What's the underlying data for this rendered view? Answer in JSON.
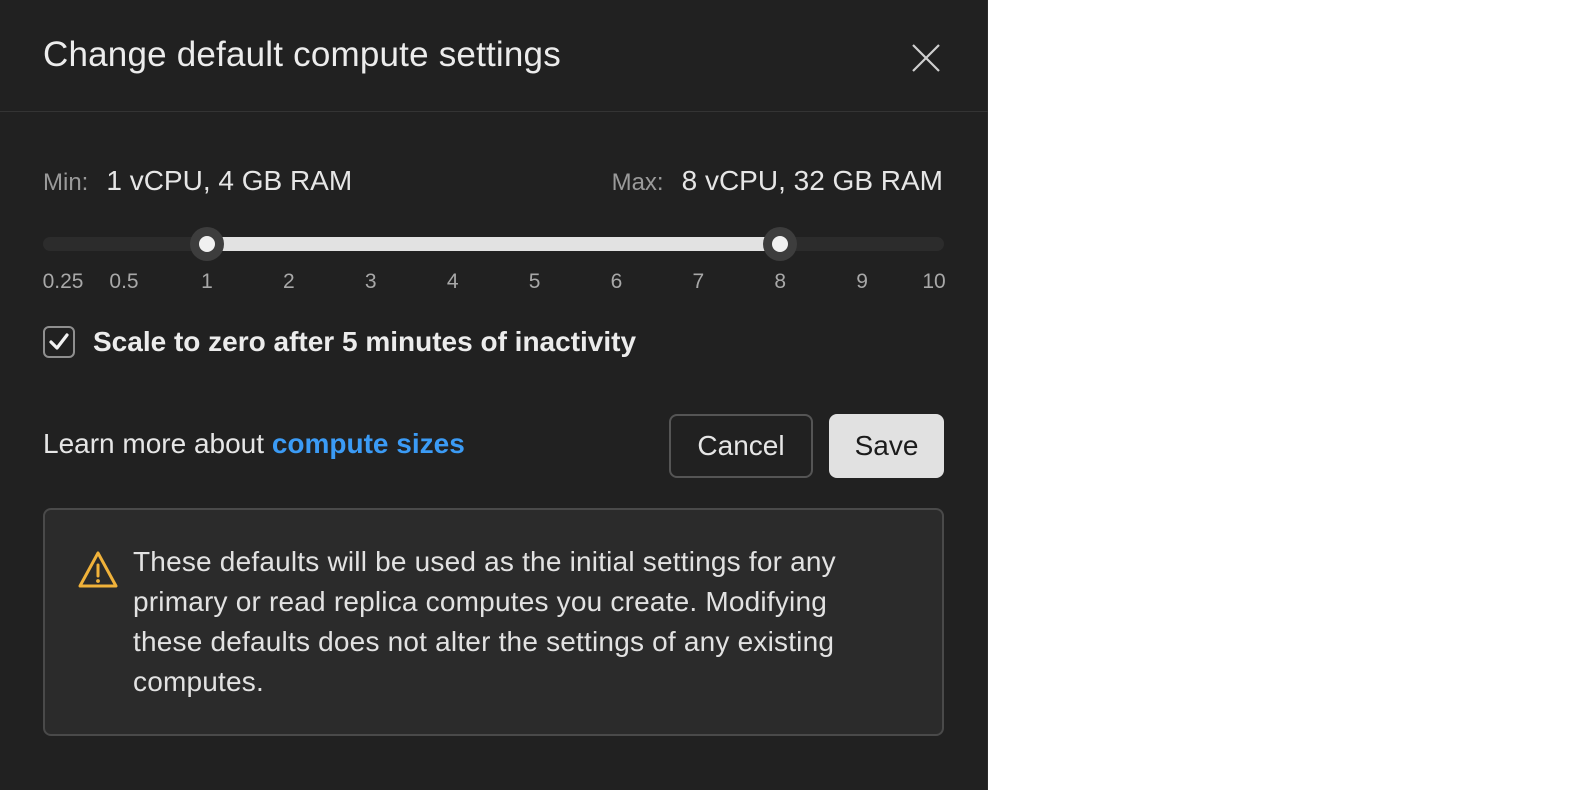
{
  "dialog": {
    "title": "Change default compute settings",
    "close_icon": "close-icon"
  },
  "compute_range": {
    "min_key": "Min:",
    "min_value": "1 vCPU, 4 GB RAM",
    "max_key": "Max:",
    "max_value": "8 vCPU, 32 GB RAM",
    "slider_min_cu": 1,
    "slider_max_cu": 8,
    "ticks": [
      "0.25",
      "0.5",
      "1",
      "2",
      "3",
      "4",
      "5",
      "6",
      "7",
      "8",
      "9",
      "10"
    ]
  },
  "scale_to_zero": {
    "checked": true,
    "label": "Scale to zero after 5 minutes of inactivity"
  },
  "footer": {
    "learn_prefix": "Learn more about ",
    "learn_link": "compute sizes",
    "cancel_label": "Cancel",
    "save_label": "Save"
  },
  "notice": {
    "icon": "warning-icon",
    "icon_color": "#f0b23a",
    "text": "These defaults will be used as the initial settings for any primary or read replica computes you create. Modifying these defaults does not alter the settings of any existing computes."
  },
  "colors": {
    "background": "#212121",
    "link": "#3b9bf5",
    "save_button": "#e1e1e1"
  }
}
